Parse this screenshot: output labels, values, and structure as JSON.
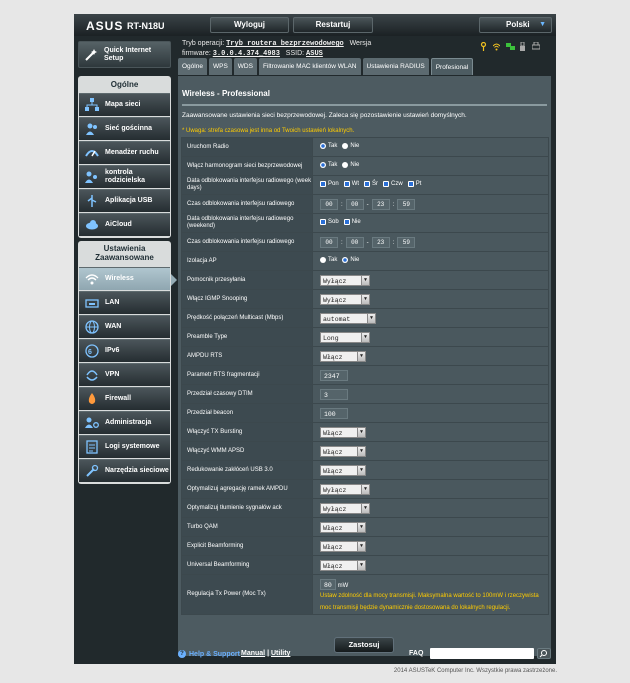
{
  "header": {
    "brand": "ASUS",
    "model": "RT-N18U",
    "logout": "Wyloguj",
    "restart": "Restartuj",
    "language": "Polski"
  },
  "info": {
    "mode_label": "Tryb operacji:",
    "mode_value": "Tryb routera bezprzewodowego",
    "version_label": "Wersja",
    "firmware_label": "firmware:",
    "firmware_value": "3.0.0.4.374_4983",
    "ssid_label": "SSID:",
    "ssid_value": "ASUS"
  },
  "sidebar": {
    "quick": "Quick Internet Setup",
    "general_title": "Ogólne",
    "general": [
      {
        "label": "Mapa sieci",
        "icon": "network-map-icon"
      },
      {
        "label": "Sieć gościnna",
        "icon": "guest-network-icon"
      },
      {
        "label": "Menadżer ruchu",
        "icon": "traffic-manager-icon"
      },
      {
        "label": "kontrola rodzicielska",
        "icon": "parental-control-icon"
      },
      {
        "label": "Aplikacja USB",
        "icon": "usb-icon"
      },
      {
        "label": "AiCloud",
        "icon": "cloud-icon"
      }
    ],
    "advanced_title": "Ustawienia Zaawansowane",
    "advanced": [
      {
        "label": "Wireless",
        "icon": "wireless-icon"
      },
      {
        "label": "LAN",
        "icon": "lan-icon"
      },
      {
        "label": "WAN",
        "icon": "wan-icon"
      },
      {
        "label": "IPv6",
        "icon": "ipv6-icon"
      },
      {
        "label": "VPN",
        "icon": "vpn-icon"
      },
      {
        "label": "Firewall",
        "icon": "firewall-icon"
      },
      {
        "label": "Administracja",
        "icon": "administration-icon"
      },
      {
        "label": "Logi systemowe",
        "icon": "system-log-icon"
      },
      {
        "label": "Narzędzia sieciowe",
        "icon": "network-tools-icon"
      }
    ]
  },
  "tabs": [
    "Ogólne",
    "WPS",
    "WDS",
    "Filtrowanie MAC klientów WLAN",
    "Ustawienia RADIUS",
    "Profesional"
  ],
  "panel": {
    "title": "Wireless - Professional",
    "description": "Zaawansowane ustawienia sieci bezprzewodowej. Zaleca się pozostawienie ustawień domyślnych.",
    "warning": "* Uwaga: strefa czasowa jest inna od Twoich ustawień lokalnych.",
    "apply": "Zastosuj"
  },
  "settings": {
    "radio": {
      "label": "Uruchom Radio",
      "yes": "Tak",
      "no": "Nie"
    },
    "schedule": {
      "label": "Włącz harmonogram sieci bezprzewodowej",
      "yes": "Tak",
      "no": "Nie"
    },
    "weekdays": {
      "label": "Data odblokowania interfejsu radiowego (week days)",
      "days": [
        "Pon",
        "Wt",
        "Śr",
        "Czw",
        "Pt"
      ]
    },
    "weekday_time": {
      "label": "Czas odblokowania interfejsu radiowego",
      "h1": "00",
      "m1": "00",
      "h2": "23",
      "m2": "59"
    },
    "weekend": {
      "label": "Data odblokowania interfejsu radiowego (weekend)",
      "days": [
        "Sob",
        "Nie"
      ]
    },
    "weekend_time": {
      "label": "Czas odblokowania interfejsu radiowego",
      "h1": "00",
      "m1": "00",
      "h2": "23",
      "m2": "59"
    },
    "ap_isolation": {
      "label": "Izolacja AP",
      "yes": "Tak",
      "no": "Nie"
    },
    "tx_assist": {
      "label": "Pomocnik przesyłania",
      "value": "Wyłącz"
    },
    "igmp": {
      "label": "Włącz IGMP Snooping",
      "value": "Wyłącz"
    },
    "multicast": {
      "label": "Prędkość połączeń Multicast (Mbps)",
      "value": "automat"
    },
    "preamble": {
      "label": "Preamble Type",
      "value": "Long"
    },
    "ampdu_rts": {
      "label": "AMPDU RTS",
      "value": "Włącz"
    },
    "rts": {
      "label": "Parametr RTS fragmentacji",
      "value": "2347"
    },
    "dtim": {
      "label": "Przedział czasowy DTIM",
      "value": "3"
    },
    "beacon": {
      "label": "Przedział beacon",
      "value": "100"
    },
    "tx_burst": {
      "label": "Włączyć TX Bursting",
      "value": "Włącz"
    },
    "wmm_apsd": {
      "label": "Włączyć WMM APSD",
      "value": "Włącz"
    },
    "usb3": {
      "label": "Redukowanie zakłóceń USB 3.0",
      "value": "Włącz"
    },
    "ampdu_agg": {
      "label": "Optymalizuj agregację ramek AMPDU",
      "value": "Wyłącz"
    },
    "ack": {
      "label": "Optymalizuj tłumienie sygnałów ack",
      "value": "Wyłącz"
    },
    "turbo_qam": {
      "label": "Turbo QAM",
      "value": "Włącz"
    },
    "explicit_bf": {
      "label": "Explicit Beamforming",
      "value": "Włącz"
    },
    "universal_bf": {
      "label": "Universal Beamforming",
      "value": "Włącz"
    },
    "txpower": {
      "label": "Regulacja Tx Power (Moc Tx)",
      "value": "80",
      "unit": "mW",
      "note": "Ustaw zdolność dla mocy transmisji. Maksymalna wartość to 100mW i rzeczywista moc transmisji będzie dynamicznie dostosowana do lokalnych regulacji."
    }
  },
  "footer": {
    "help": "Help & Support",
    "manual": "Manual",
    "utility": "Utility",
    "faq": "FAQ",
    "copyright": "2014 ASUSTeK Computer Inc. Wszystkie prawa zastrzeżone."
  },
  "colors": {
    "accent": "#6ab0ff",
    "warning": "#ffcc00",
    "panel": "#4d5b61"
  }
}
